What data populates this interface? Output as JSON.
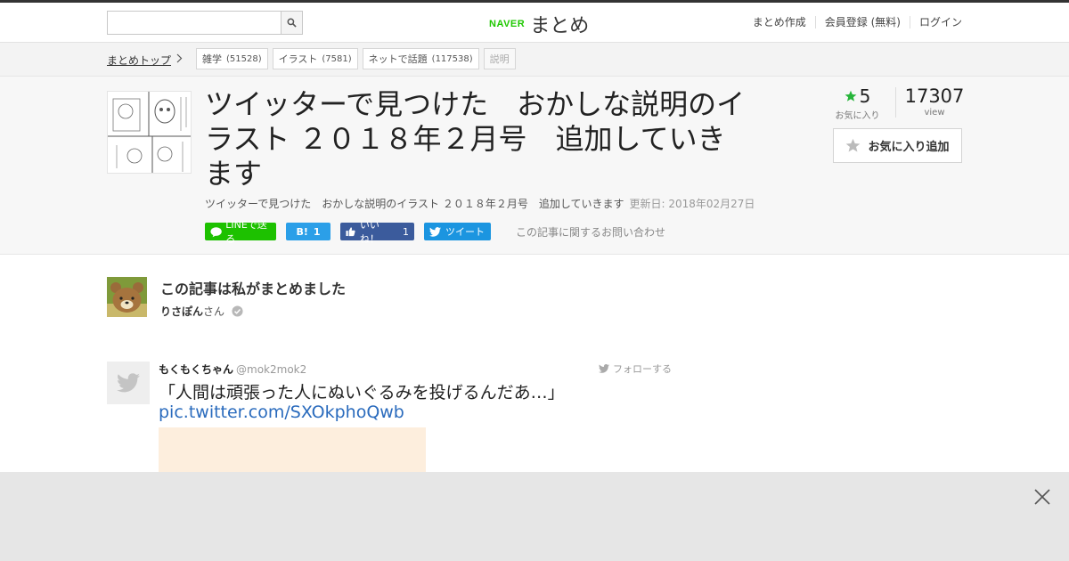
{
  "header": {
    "search_placeholder": "",
    "logo_brand": "NAVER",
    "logo_name": "まとめ",
    "nav": [
      "まとめ作成",
      "会員登録 (無料)",
      "ログイン"
    ]
  },
  "breadcrumb": {
    "top": "まとめトップ",
    "tags": [
      {
        "label": "雑学",
        "count": "(51528)"
      },
      {
        "label": "イラスト",
        "count": "(7581)"
      },
      {
        "label": "ネットで話題",
        "count": "(117538)"
      }
    ],
    "plain_tag": "説明"
  },
  "article": {
    "title": "ツイッターで見つけた　おかしな説明のイラスト ２０１８年２月号　追加していきます",
    "description": "ツイッターで見つけた　おかしな説明のイラスト ２０１８年２月号　追加していきます",
    "updated": "更新日: 2018年02月27日",
    "favorites": "5",
    "favorites_label": "お気に入り",
    "views": "17307",
    "views_label": "view",
    "fav_button": "お気に入り追加"
  },
  "share": {
    "line": "LINEで送る",
    "hatena": "B!",
    "hatena_count": "1",
    "fb": "いいね！",
    "fb_count": "1",
    "tw": "ツイート",
    "contact": "この記事に関するお問い合わせ"
  },
  "author": {
    "heading": "この記事は私がまとめました",
    "name": "りさぽん",
    "suffix": "さん"
  },
  "tweet": {
    "user": "もくもくちゃん",
    "handle": "@mok2mok2",
    "follow": "フォローする",
    "text": "「人間は頑張った人にぬいぐるみを投げるんだあ…」",
    "link": "pic.twitter.com/SXOkphoQwb"
  },
  "colors": {
    "naver_green": "#1ec800",
    "line": "#1dc100",
    "hatena": "#2b9fe8",
    "facebook": "#3b5b9c",
    "twitter": "#1b95e0",
    "link": "#2a6bbd",
    "star": "#27b53a"
  }
}
